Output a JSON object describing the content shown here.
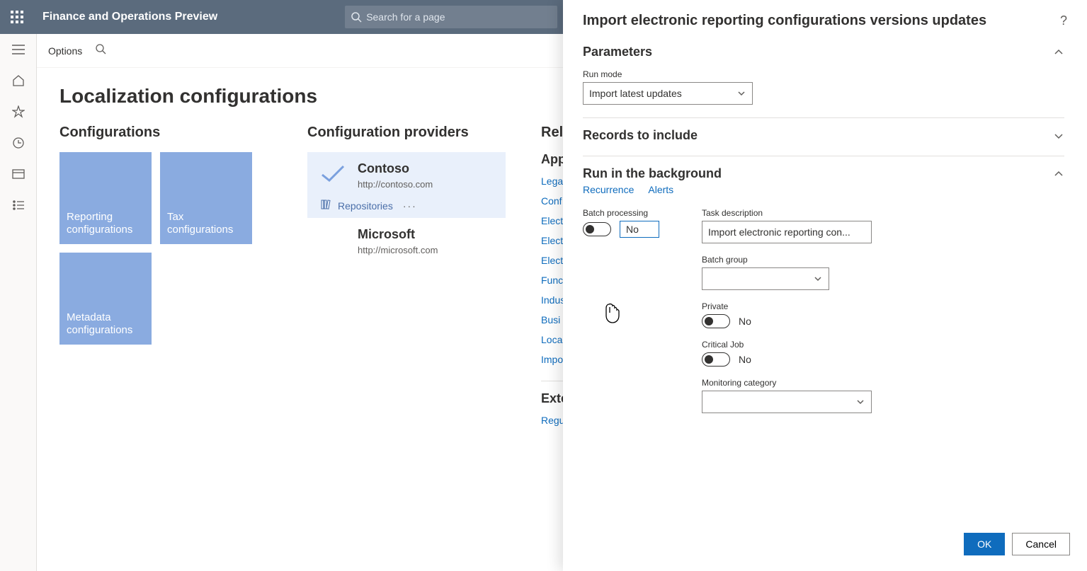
{
  "header": {
    "app_title": "Finance and Operations Preview",
    "search_placeholder": "Search for a page"
  },
  "subbar": {
    "options": "Options"
  },
  "leftrail": {
    "items": [
      "hamburger",
      "home",
      "star",
      "clock",
      "card",
      "list"
    ]
  },
  "page": {
    "title": "Localization configurations",
    "configurations": {
      "heading": "Configurations",
      "tiles": [
        "Reporting configurations",
        "Tax configurations",
        "Metadata configurations"
      ]
    },
    "providers": {
      "heading": "Configuration providers",
      "list": [
        {
          "name": "Contoso",
          "url": "http://contoso.com",
          "active": true,
          "repositories_label": "Repositories"
        },
        {
          "name": "Microsoft",
          "url": "http://microsoft.com",
          "active": false
        }
      ]
    },
    "related": {
      "heading": "Rela",
      "group1": "App",
      "links": [
        "Lega",
        "Conf",
        "Elect",
        "Elect",
        "Elect",
        "Func",
        "Indus",
        "Busi",
        "Loca",
        "Impo"
      ],
      "group2": "Exte",
      "links2": [
        "Regu"
      ]
    }
  },
  "flyout": {
    "title": "Import electronic reporting configurations versions updates",
    "sections": {
      "parameters": {
        "title": "Parameters",
        "run_mode_label": "Run mode",
        "run_mode_value": "Import latest updates"
      },
      "records": {
        "title": "Records to include"
      },
      "background": {
        "title": "Run in the background",
        "recurrence": "Recurrence",
        "alerts": "Alerts",
        "batch_processing_label": "Batch processing",
        "batch_processing_value": "No",
        "task_description_label": "Task description",
        "task_description_value": "Import electronic reporting con...",
        "batch_group_label": "Batch group",
        "batch_group_value": "",
        "private_label": "Private",
        "private_value": "No",
        "critical_label": "Critical Job",
        "critical_value": "No",
        "monitoring_label": "Monitoring category"
      }
    },
    "buttons": {
      "ok": "OK",
      "cancel": "Cancel"
    }
  }
}
